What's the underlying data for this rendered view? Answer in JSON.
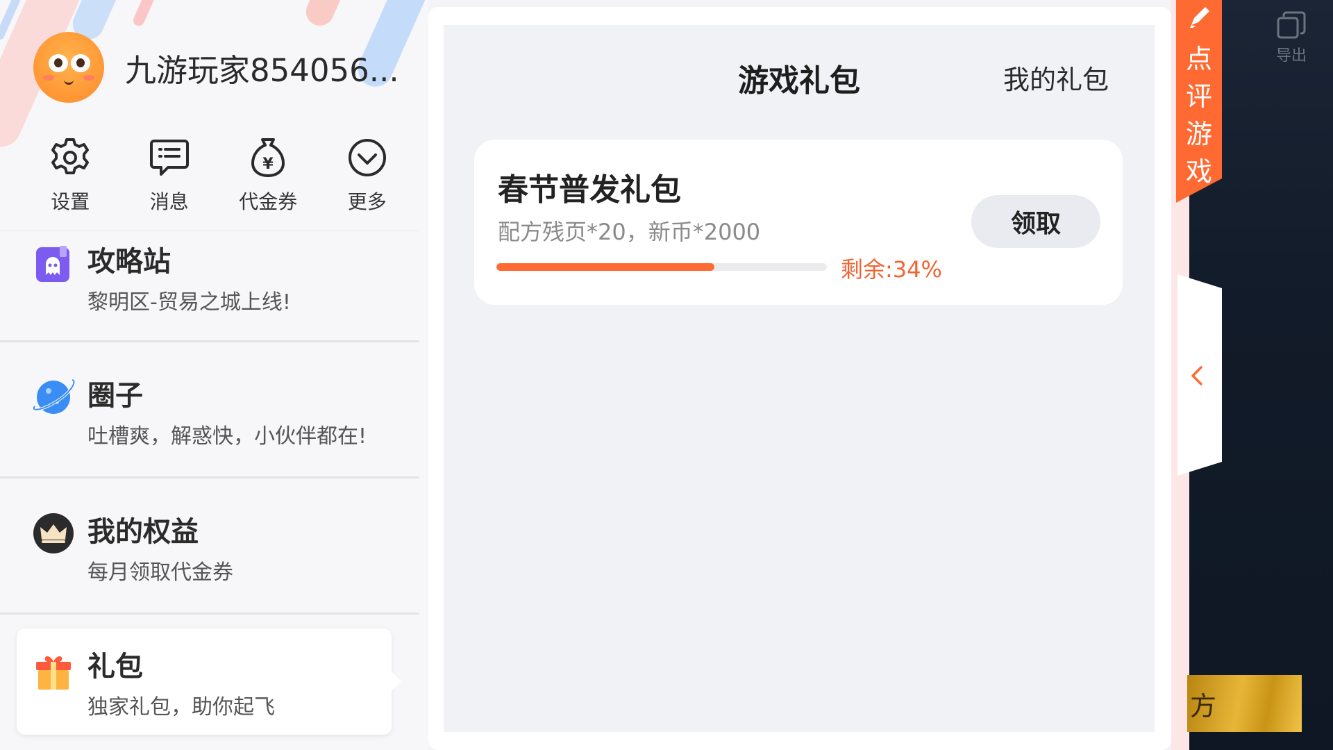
{
  "profile": {
    "username": "九游玩家854056..."
  },
  "quick_actions": [
    {
      "label": "设置",
      "icon": "gear-icon"
    },
    {
      "label": "消息",
      "icon": "message-icon"
    },
    {
      "label": "代金券",
      "icon": "coupon-icon"
    },
    {
      "label": "更多",
      "icon": "chevron-down-circle-icon"
    }
  ],
  "menu": [
    {
      "title": "攻略站",
      "subtitle": "黎明区-贸易之城上线!",
      "icon": "guide-station-icon"
    },
    {
      "title": "圈子",
      "subtitle": "吐槽爽，解惑快，小伙伴都在!",
      "icon": "planet-icon"
    },
    {
      "title": "我的权益",
      "subtitle": "每月领取代金券",
      "icon": "crown-icon"
    },
    {
      "title": "礼包",
      "subtitle": "独家礼包，助你起飞",
      "icon": "gift-icon",
      "selected": true
    }
  ],
  "gift_page": {
    "title": "游戏礼包",
    "my_gifts_link": "我的礼包"
  },
  "gift_card": {
    "name": "春节普发礼包",
    "description": "配方残页*20，新币*2000",
    "remaining_text": "剩余:34%",
    "progress_fill": 0.66,
    "claim_label": "领取"
  },
  "side": {
    "review_tab_text": "点评游戏",
    "export_label": "导出",
    "banner_char": "方"
  },
  "colors": {
    "accent": "#ff6a33",
    "remaining": "#f06433"
  }
}
